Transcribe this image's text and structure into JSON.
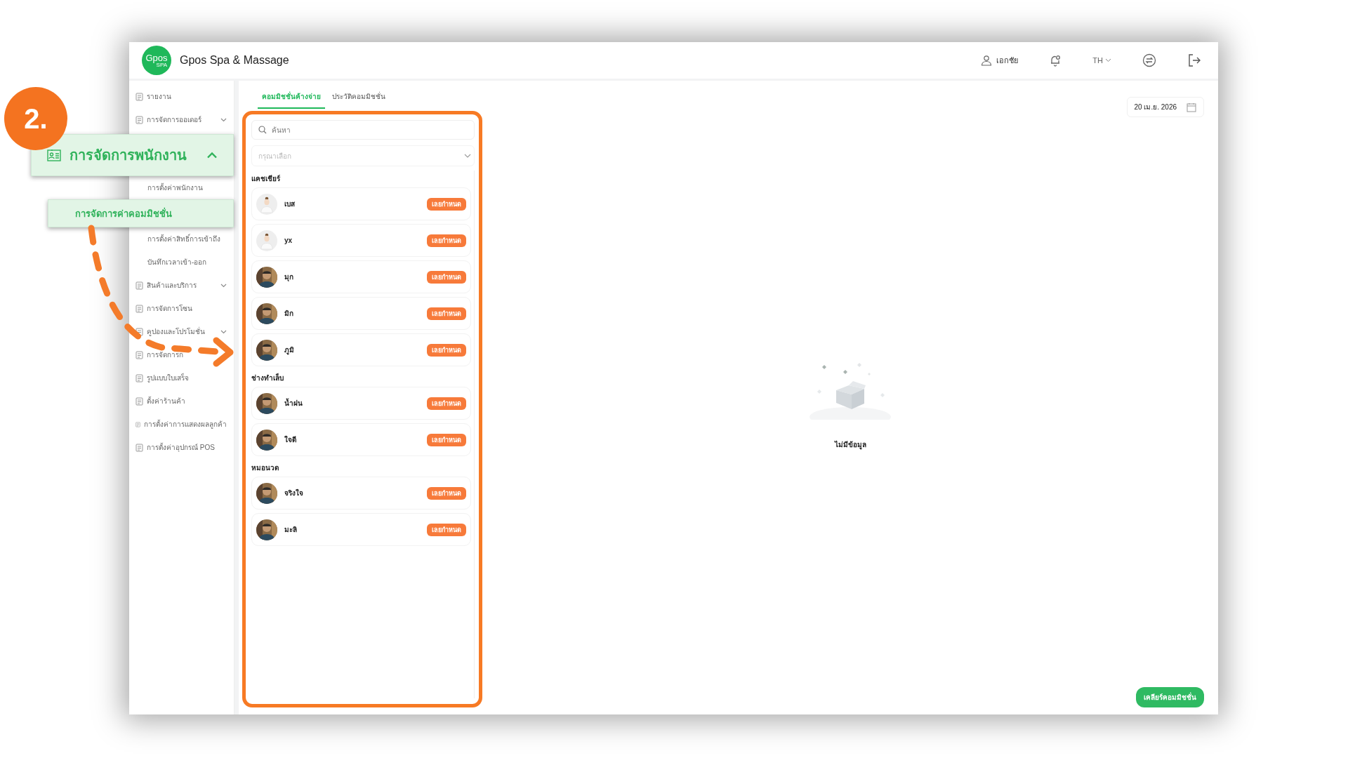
{
  "header": {
    "logo": {
      "main": "Gpos",
      "sub": "SPA"
    },
    "title": "Gpos Spa & Massage",
    "user": "เอกชัย",
    "language": "TH"
  },
  "sidebar": {
    "items": [
      {
        "kind": "item",
        "label": "รายงาน",
        "expandable": false
      },
      {
        "kind": "item",
        "label": "การจัดการออเดอร์",
        "expandable": true
      },
      {
        "kind": "callout-group",
        "label": "การจัดการพนักงาน",
        "expanded": true
      },
      {
        "kind": "sub",
        "label": "การตั้งค่าพนักงาน"
      },
      {
        "kind": "callout-sub",
        "label": "การจัดการค่าคอมมิชชั่น"
      },
      {
        "kind": "sub",
        "label": "การตั้งค่าสิทธิ์การเข้าถึง"
      },
      {
        "kind": "sub",
        "label": "บันทึกเวลาเข้า-ออก"
      },
      {
        "kind": "item",
        "label": "สินค้าและบริการ",
        "expandable": true
      },
      {
        "kind": "item",
        "label": "การจัดการโซน",
        "expandable": false
      },
      {
        "kind": "item",
        "label": "คูปองและโปรโมชั่น",
        "expandable": true
      },
      {
        "kind": "item",
        "label": "การจัดการก",
        "expandable": false
      },
      {
        "kind": "item",
        "label": "รูปแบบใบเสร็จ",
        "expandable": false
      },
      {
        "kind": "item",
        "label": "ตั้งค่าร้านค้า",
        "expandable": false
      },
      {
        "kind": "item",
        "label": "การตั้งค่าการแสดงผลลูกค้า",
        "expandable": false
      },
      {
        "kind": "item",
        "label": "การตั้งค่าอุปกรณ์ POS",
        "expandable": false
      }
    ]
  },
  "annotation": {
    "step": "2."
  },
  "tabs": [
    {
      "label": "คอมมิชชั่นค้างจ่าย",
      "selected": true
    },
    {
      "label": "ประวัติคอมมิชชั่น",
      "selected": false
    }
  ],
  "date": "20 เม.ย. 2026",
  "search": {
    "placeholder": "ค้นหา"
  },
  "filter": {
    "placeholder": "กรุณาเลือก"
  },
  "groups": [
    {
      "title": "แคชเชียร์",
      "staff": [
        {
          "name": "เบส",
          "kind": "placeholder",
          "badge": "เลยกำหนด"
        },
        {
          "name": "yx",
          "kind": "placeholder",
          "badge": "เลยกำหนด"
        },
        {
          "name": "มุก",
          "badge": "เลยกำหนด"
        },
        {
          "name": "มิก",
          "badge": "เลยกำหนด"
        },
        {
          "name": "ภูมิ",
          "badge": "เลยกำหนด"
        }
      ]
    },
    {
      "title": "ช่างทำเล็บ",
      "staff": [
        {
          "name": "น้ำฝน",
          "badge": "เลยกำหนด"
        },
        {
          "name": "ใจดี",
          "badge": "เลยกำหนด"
        }
      ]
    },
    {
      "title": "หมอนวด",
      "staff": [
        {
          "name": "จริงใจ",
          "badge": "เลยกำหนด"
        },
        {
          "name": "มะลิ",
          "badge": "เลยกำหนด"
        }
      ]
    }
  ],
  "empty_state": {
    "message": "ไม่มีข้อมูล"
  },
  "clear_button": "เคลียร์คอมมิชชั่น"
}
